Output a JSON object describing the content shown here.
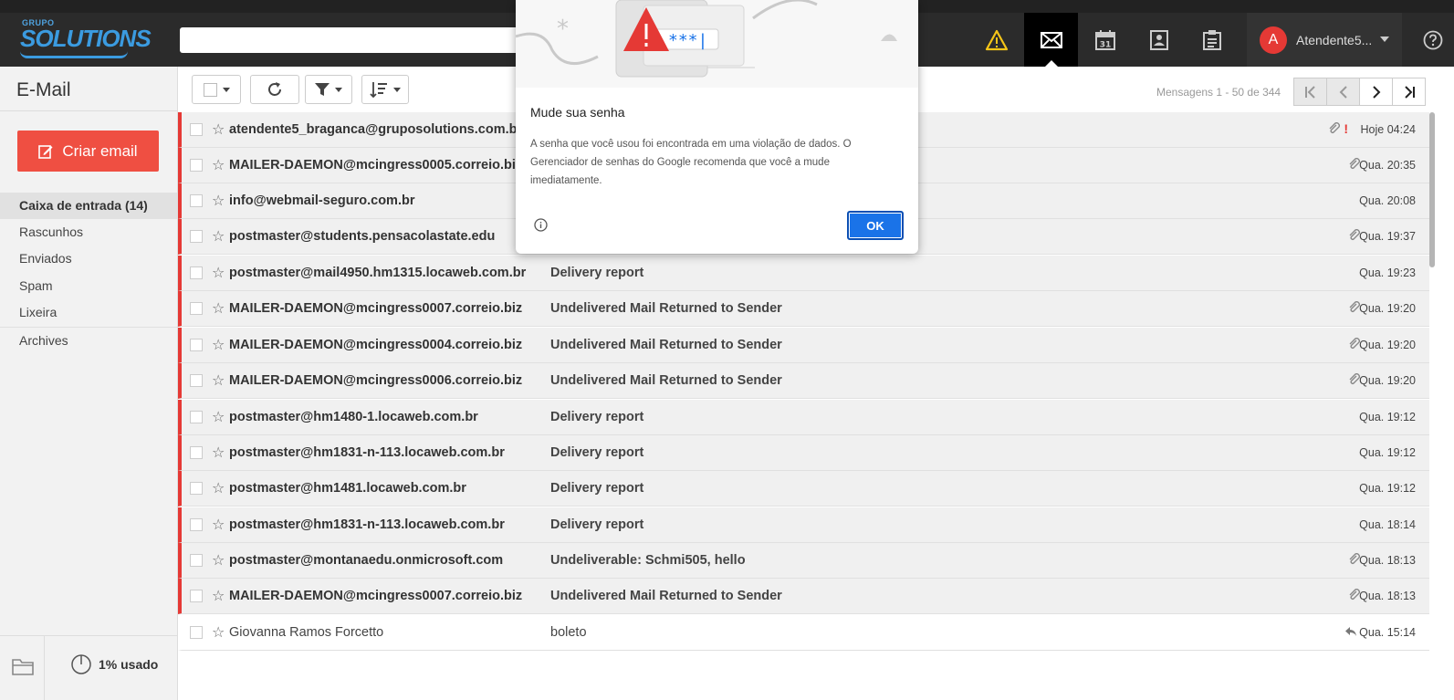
{
  "header": {
    "logo_small": "GRUPO",
    "logo_big": "SOLUTIONS",
    "search_placeholder": "",
    "icons": [
      "warning-icon",
      "mail-icon",
      "calendar-icon",
      "contacts-icon",
      "tasks-icon"
    ],
    "calendar_day": "31",
    "user_initial": "A",
    "user_name": "Atendente5...",
    "accent_color": "#e53935"
  },
  "sidebar": {
    "title": "E-Mail",
    "compose_label": "Criar email",
    "folders": [
      {
        "label": "Caixa de entrada  (14)",
        "selected": true
      },
      {
        "label": "Rascunhos"
      },
      {
        "label": "Enviados"
      },
      {
        "label": "Spam"
      },
      {
        "label": "Lixeira"
      },
      {
        "label": "Archives"
      }
    ],
    "usage": "1% usado"
  },
  "toolbar": {
    "count_text": "Mensagens 1 - 50 de 344"
  },
  "emails": [
    {
      "sender": "atendente5_braganca@gruposolutions.com.br",
      "subject": "",
      "date": "Hoje 04:24",
      "attachment": true,
      "important": true,
      "unread": true
    },
    {
      "sender": "MAILER-DAEMON@mcingress0005.correio.biz",
      "subject": "",
      "date": "Qua. 20:35",
      "attachment": true,
      "unread": true
    },
    {
      "sender": "info@webmail-seguro.com.br",
      "subject": "",
      "date": "Qua. 20:08",
      "attachment": false,
      "unread": true
    },
    {
      "sender": "postmaster@students.pensacolastate.edu",
      "subject": "",
      "date": "Qua. 19:37",
      "attachment": true,
      "unread": true
    },
    {
      "sender": "postmaster@mail4950.hm1315.locaweb.com.br",
      "subject": "Delivery report",
      "date": "Qua. 19:23",
      "attachment": false,
      "unread": true
    },
    {
      "sender": "MAILER-DAEMON@mcingress0007.correio.biz",
      "subject": "Undelivered Mail Returned to Sender",
      "date": "Qua. 19:20",
      "attachment": true,
      "unread": true
    },
    {
      "sender": "MAILER-DAEMON@mcingress0004.correio.biz",
      "subject": "Undelivered Mail Returned to Sender",
      "date": "Qua. 19:20",
      "attachment": true,
      "unread": true
    },
    {
      "sender": "MAILER-DAEMON@mcingress0006.correio.biz",
      "subject": "Undelivered Mail Returned to Sender",
      "date": "Qua. 19:20",
      "attachment": true,
      "unread": true
    },
    {
      "sender": "postmaster@hm1480-1.locaweb.com.br",
      "subject": "Delivery report",
      "date": "Qua. 19:12",
      "attachment": false,
      "unread": true
    },
    {
      "sender": "postmaster@hm1831-n-113.locaweb.com.br",
      "subject": "Delivery report",
      "date": "Qua. 19:12",
      "attachment": false,
      "unread": true
    },
    {
      "sender": "postmaster@hm1481.locaweb.com.br",
      "subject": "Delivery report",
      "date": "Qua. 19:12",
      "attachment": false,
      "unread": true
    },
    {
      "sender": "postmaster@hm1831-n-113.locaweb.com.br",
      "subject": "Delivery report",
      "date": "Qua. 18:14",
      "attachment": false,
      "unread": true
    },
    {
      "sender": "postmaster@montanaedu.onmicrosoft.com",
      "subject": "Undeliverable: Schmi505, hello",
      "date": "Qua. 18:13",
      "attachment": true,
      "unread": true
    },
    {
      "sender": "MAILER-DAEMON@mcingress0007.correio.biz",
      "subject": "Undelivered Mail Returned to Sender",
      "date": "Qua. 18:13",
      "attachment": true,
      "unread": true
    },
    {
      "sender": "Giovanna Ramos Forcetto",
      "subject": "boleto",
      "date": "Qua. 15:14",
      "attachment": false,
      "replied": true,
      "unread": false
    }
  ],
  "dialog": {
    "title": "Mude sua senha",
    "body": "A senha que você usou foi encontrada em uma violação de dados. O Gerenciador de senhas do Google recomenda que você a mude imediatamente.",
    "illustration_text": "***|",
    "ok_label": "OK"
  }
}
